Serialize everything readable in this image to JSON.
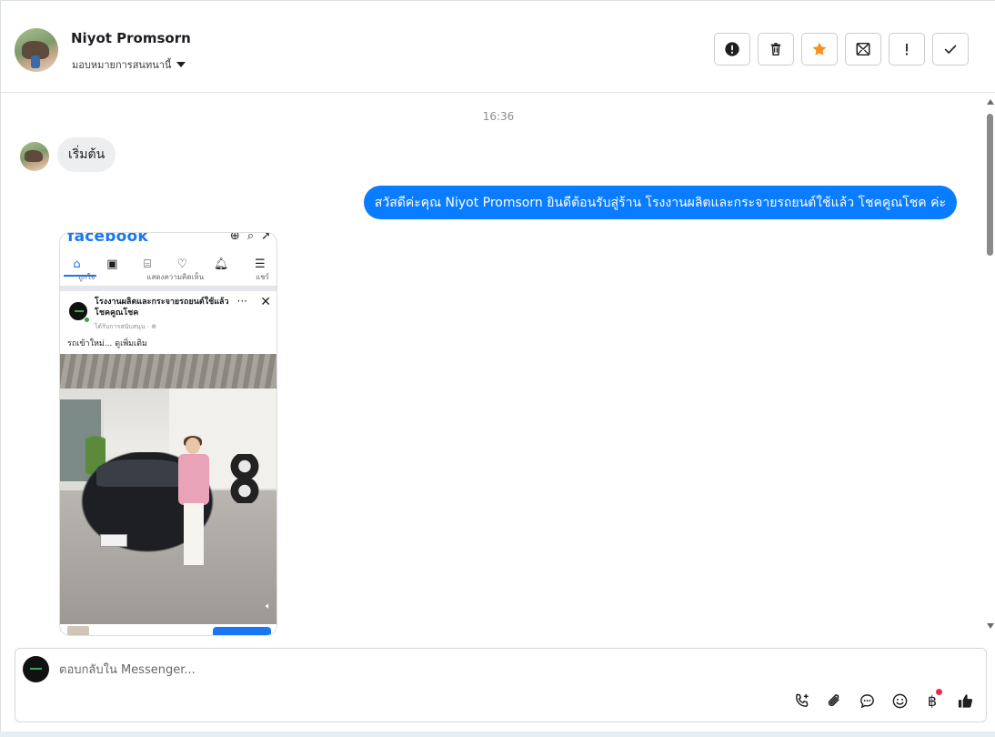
{
  "header": {
    "name": "Niyot Promsorn",
    "assign_label": "มอบหมายการสนทนานี้",
    "actions": [
      {
        "icon": "alert-circle-icon",
        "label": "report"
      },
      {
        "icon": "trash-icon",
        "label": "delete"
      },
      {
        "icon": "star-icon",
        "label": "star",
        "color": "#f5911e"
      },
      {
        "icon": "mark-unread-icon",
        "label": "mark unread"
      },
      {
        "icon": "exclamation-icon",
        "label": "flag"
      },
      {
        "icon": "check-icon",
        "label": "done"
      }
    ]
  },
  "conversation": {
    "timestamp": "16:36",
    "incoming_message": "เริ่มต้น",
    "outgoing_message": "สวัสดีค่ะคุณ Niyot Promsorn ยินดีต้อนรับสู่ร้าน โรงงานผลิตและกระจายรถยนต์ใช้แล้ว โชคคูณโชค ค่ะ",
    "outgoing_color": "#0a7cff"
  },
  "shared_screenshot": {
    "fb_logo": "facebook",
    "reacts": [
      "ถูกใจ",
      "แสดงความคิดเห็น",
      "แชร์"
    ],
    "post_page": "โรงงานผลิตและกระจายรถยนต์ใช้แล้ว โชคคูณโชค",
    "post_sub": "ได้รับการสนับสนุน · ⊕",
    "post_text": "รถเข้าใหม่... ดูเพิ่มเติม"
  },
  "composer": {
    "placeholder": "ตอบกลับใน Messenger...",
    "tools": [
      "call-add-icon",
      "attachment-icon",
      "saved-reply-icon",
      "emoji-icon",
      "baht-payment-icon",
      "thumbs-up-icon"
    ]
  }
}
